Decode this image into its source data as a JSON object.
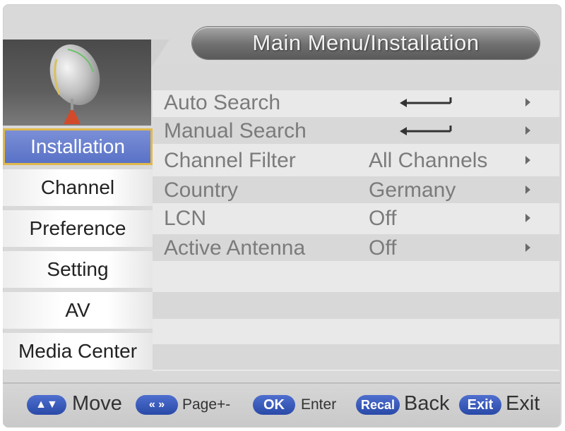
{
  "title": "Main Menu/Installation",
  "sidebar": {
    "items": [
      {
        "label": "Installation",
        "active": true
      },
      {
        "label": "Channel",
        "active": false
      },
      {
        "label": "Preference",
        "active": false
      },
      {
        "label": "Setting",
        "active": false
      },
      {
        "label": "AV",
        "active": false
      },
      {
        "label": "Media Center",
        "active": false
      }
    ]
  },
  "menu": {
    "rows": [
      {
        "label": "Auto Search",
        "value": "",
        "icon": "enter-arrow-icon"
      },
      {
        "label": "Manual Search",
        "value": "",
        "icon": "enter-arrow-icon"
      },
      {
        "label": "Channel Filter",
        "value": "All Channels"
      },
      {
        "label": "Country",
        "value": "Germany"
      },
      {
        "label": "LCN",
        "value": "Off"
      },
      {
        "label": "Active Antenna",
        "value": "Off"
      }
    ]
  },
  "footer": {
    "move_label": "Move",
    "page_label": "Page+-",
    "ok_key": "OK",
    "enter_label": "Enter",
    "recall_key": "Recal",
    "back_label": "Back",
    "exit_key": "Exit",
    "exit_label": "Exit"
  },
  "colors": {
    "active_item": "#5a72c7",
    "active_border": "#e0b84a",
    "key_blue": "#2a4aa8",
    "row_text": "#7b7b7b"
  }
}
